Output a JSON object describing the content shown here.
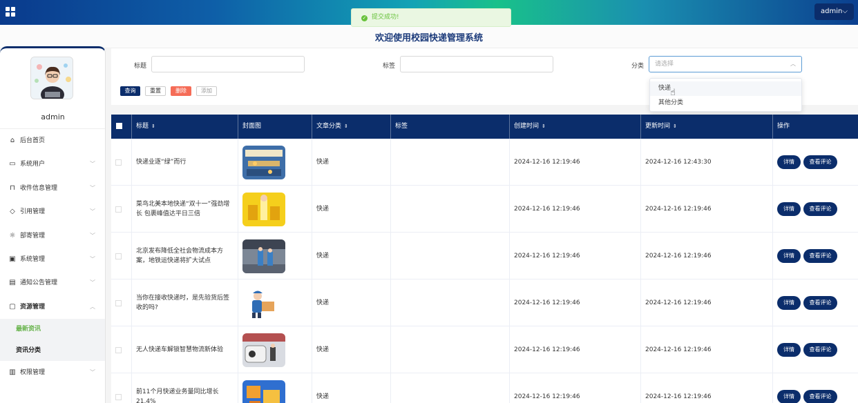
{
  "header": {
    "admin_label": "admin",
    "admin_caret": "⌵",
    "toast_text": "提交成功!",
    "page_title": "欢迎使用校园快递管理系统"
  },
  "sidebar": {
    "username": "admin",
    "items": [
      {
        "label": "后台首页",
        "icon": "home-icon"
      },
      {
        "label": "系统用户",
        "icon": "monitor-icon"
      },
      {
        "label": "收件信息管理",
        "icon": "bookmark-icon"
      },
      {
        "label": "引用管理",
        "icon": "tag-icon"
      },
      {
        "label": "部寄管理",
        "icon": "sun-icon"
      },
      {
        "label": "系统管理",
        "icon": "inbox-icon"
      },
      {
        "label": "通知公告管理",
        "icon": "clipboard-icon"
      },
      {
        "label": "资源管理",
        "icon": "chat-icon"
      },
      {
        "label": "权限管理",
        "icon": "archive-icon"
      }
    ],
    "subitems": [
      "最新资讯",
      "资讯分类"
    ]
  },
  "filter": {
    "title_label": "标题",
    "tag_label": "标签",
    "category_label": "分类",
    "category_placeholder": "请选择",
    "category_options": [
      "快递",
      "其他分类"
    ],
    "buttons": {
      "query": "查询",
      "reset": "重置",
      "delete": "删除",
      "add": "添加"
    }
  },
  "table": {
    "headers": [
      "标题",
      "封面图",
      "文章分类",
      "标签",
      "创建时间",
      "更新时间",
      "操作"
    ],
    "rows": [
      {
        "title": "快递业逐“绿”而行",
        "category": "快递",
        "tag": "",
        "created": "2024-12-16 12:19:46",
        "updated": "2024-12-16 12:43:30"
      },
      {
        "title": "菜鸟北美本地快递“双十一”强劲增长 包裹峰值达平日三倍",
        "category": "快递",
        "tag": "",
        "created": "2024-12-16 12:19:46",
        "updated": "2024-12-16 12:19:46"
      },
      {
        "title": "北京发布降低全社会物流成本方案，地铁运快递将扩大试点",
        "category": "快递",
        "tag": "",
        "created": "2024-12-16 12:19:46",
        "updated": "2024-12-16 12:19:46"
      },
      {
        "title": "当你在接收快递时，是先验货后签收的吗?",
        "category": "快递",
        "tag": "",
        "created": "2024-12-16 12:19:46",
        "updated": "2024-12-16 12:19:46"
      },
      {
        "title": "无人快递车解锁智慧物流新体验",
        "category": "快递",
        "tag": "",
        "created": "2024-12-16 12:19:46",
        "updated": "2024-12-16 12:19:46"
      },
      {
        "title": "前11个月快递业务量同比增长21.4%",
        "category": "快递",
        "tag": "",
        "created": "2024-12-16 12:19:46",
        "updated": "2024-12-16 12:19:46"
      }
    ],
    "detail_label": "详情",
    "comment_label": "查看评论"
  }
}
